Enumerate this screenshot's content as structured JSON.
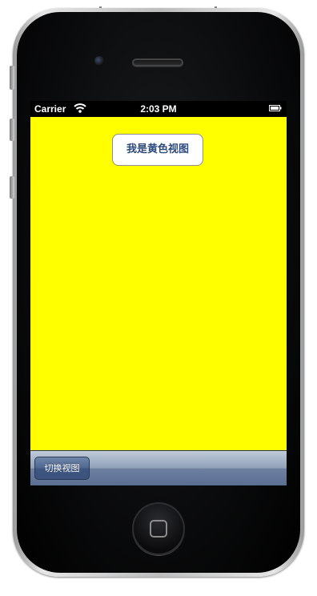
{
  "status_bar": {
    "carrier": "Carrier",
    "time": "2:03 PM",
    "wifi_icon": "wifi-icon",
    "battery_icon": "battery-icon"
  },
  "main": {
    "background_color": "#ffff00",
    "label_button_text": "我是黄色视图"
  },
  "toolbar": {
    "switch_button_label": "切换视图"
  },
  "device": {
    "home_button_icon": "home-square-icon"
  }
}
